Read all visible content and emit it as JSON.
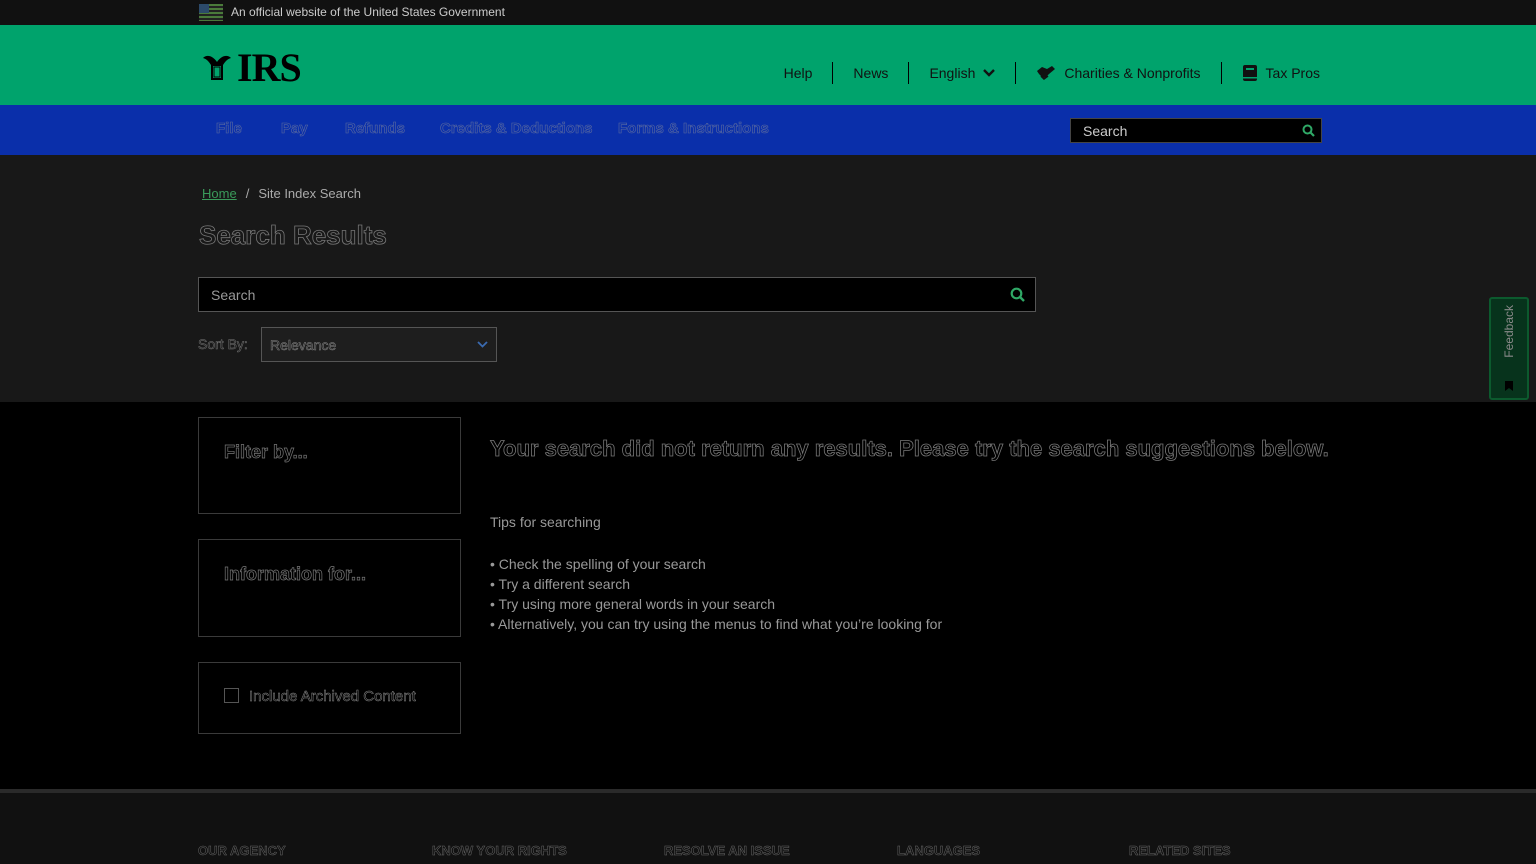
{
  "gov_banner": {
    "text": "An official website of the United States Government"
  },
  "header": {
    "logo_text": "IRS",
    "utility_nav": [
      {
        "label": "Help"
      },
      {
        "label": "News"
      },
      {
        "label": "English"
      },
      {
        "label": "Charities & Nonprofits",
        "icon": "handshake-icon"
      },
      {
        "label": "Tax Pros",
        "icon": "book-icon"
      }
    ]
  },
  "main_nav": {
    "items": [
      "File",
      "Pay",
      "Refunds",
      "Credits & Deductions",
      "Forms & Instructions"
    ],
    "search_placeholder": "Search"
  },
  "breadcrumb": {
    "home": "Home",
    "separator": "/",
    "current": "Site Index Search"
  },
  "page_title": "Search Results",
  "search": {
    "placeholder": "Search"
  },
  "sort": {
    "label": "Sort By:",
    "value": "Relevance"
  },
  "feedback": {
    "label": "Feedback"
  },
  "sidebar": {
    "filter_title": "Filter by...",
    "info_title": "Information for...",
    "archived_label": "Include Archived Content",
    "archived_checked": false
  },
  "results": {
    "no_results": "Your search did not return any results. Please try the search suggestions below.",
    "tips_title": "Tips for searching",
    "tips": [
      "• Check the spelling of your search",
      "• Try a different search",
      "• Try using more general words in your search",
      "• Alternatively, you can try using the menus to find what you’re looking for"
    ]
  },
  "footer": {
    "headings": [
      "Our Agency",
      "Know Your Rights",
      "Resolve an Issue",
      "Languages",
      "Related Sites"
    ]
  },
  "colors": {
    "header_green": "#00a36c",
    "nav_blue": "#0a2faa",
    "link_green": "#3a9a5a"
  }
}
